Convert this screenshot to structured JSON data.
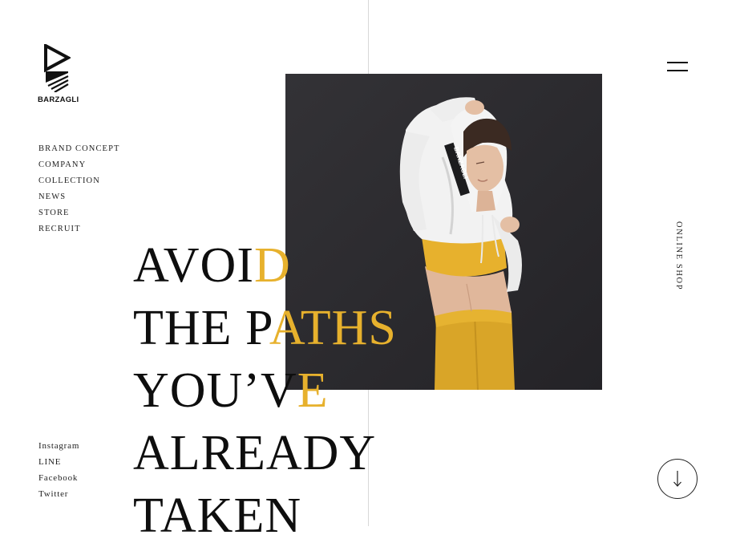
{
  "brand": {
    "name": "BARZAGLI"
  },
  "nav": {
    "items": [
      {
        "label": "BRAND CONCEPT"
      },
      {
        "label": "COMPANY"
      },
      {
        "label": "COLLECTION"
      },
      {
        "label": "NEWS"
      },
      {
        "label": "STORE"
      },
      {
        "label": "RECRUIT"
      }
    ]
  },
  "social": {
    "items": [
      {
        "label": "Instagram"
      },
      {
        "label": "LINE"
      },
      {
        "label": "Facebook"
      },
      {
        "label": "Twitter"
      }
    ]
  },
  "headline": {
    "lines": [
      {
        "dark": "AVOI",
        "gold": "D"
      },
      {
        "dark": "THE P",
        "gold": "ATHS"
      },
      {
        "dark": "YOU’V",
        "gold": "E"
      },
      {
        "dark": "ALREADY",
        "gold": ""
      },
      {
        "dark": "TAKEN",
        "gold": ""
      }
    ]
  },
  "hero": {
    "hood_text": "BARZAGLI"
  },
  "side": {
    "online_shop_label": "ONLINE SHOP"
  },
  "icons": {
    "menu": "hamburger-icon",
    "scroll": "arrow-down-icon",
    "logo": "play-triangle-logo"
  },
  "colors": {
    "accent": "#e7b12d",
    "photo_bg": "#2b2a2e",
    "text": "#1a1a1a"
  }
}
